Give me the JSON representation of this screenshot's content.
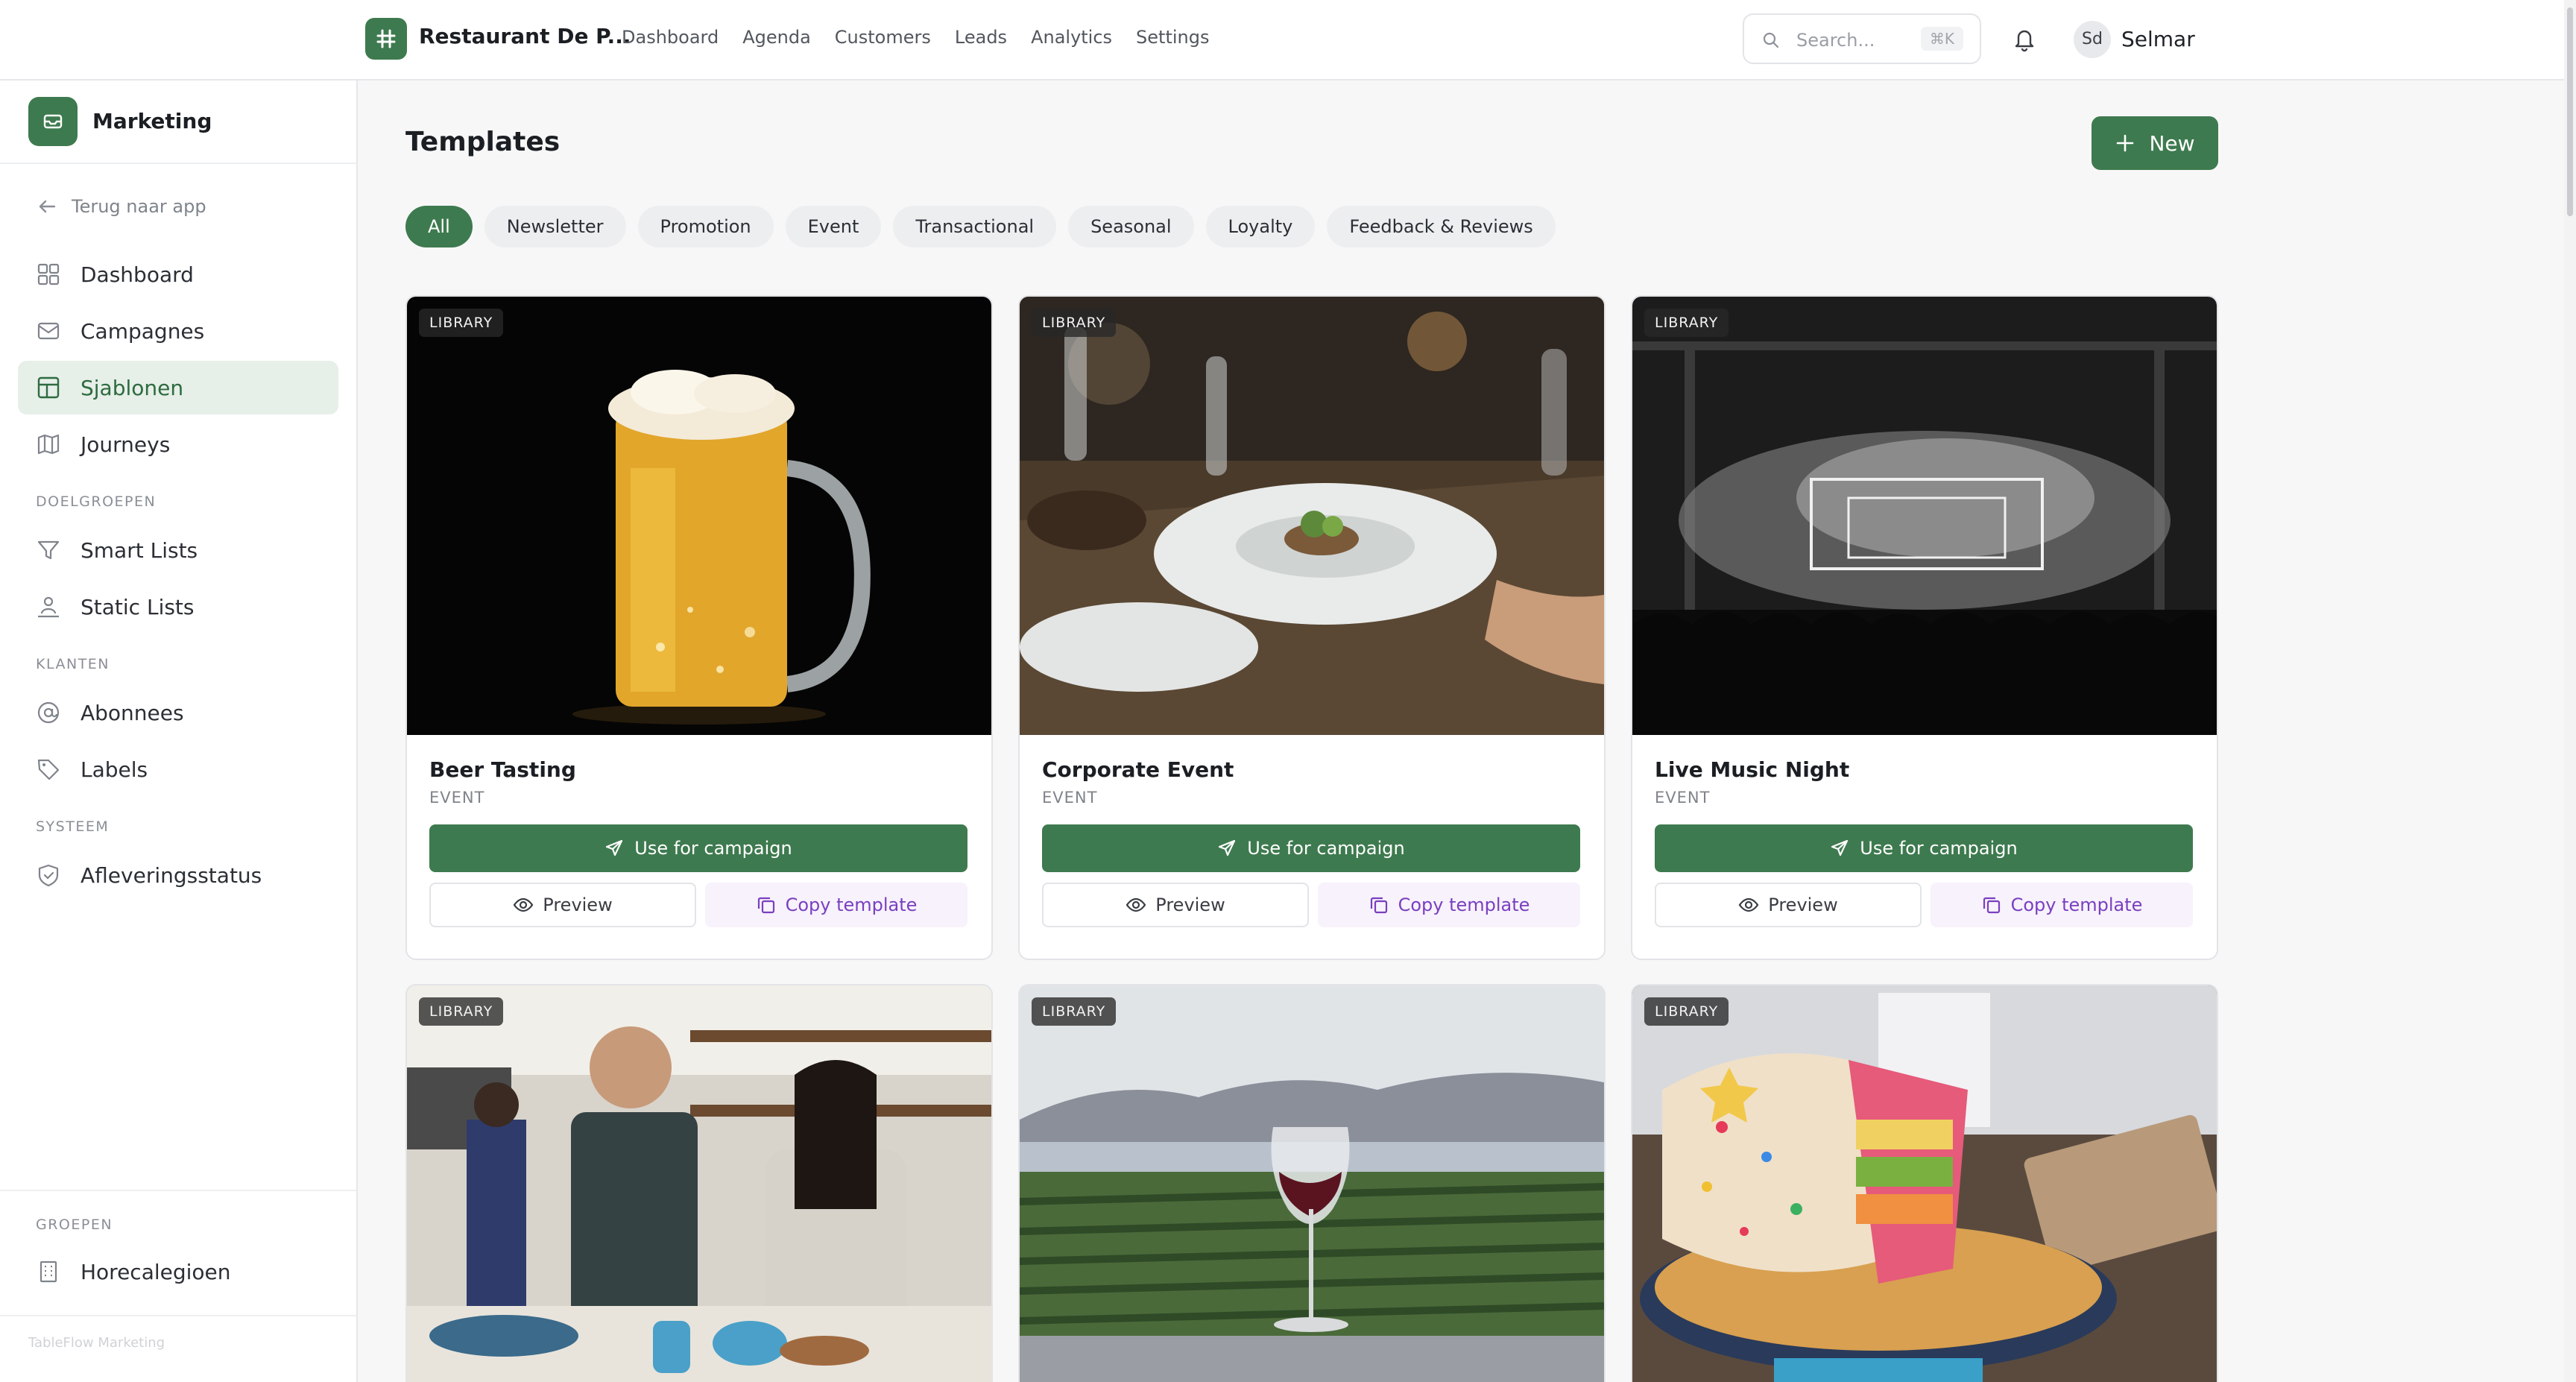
{
  "header": {
    "brand": "Restaurant De P...",
    "nav": [
      "Dashboard",
      "Agenda",
      "Customers",
      "Leads",
      "Analytics",
      "Settings"
    ],
    "search_placeholder": "Search...",
    "search_shortcut": "⌘K",
    "user_initials": "Sd",
    "user_name": "Selmar"
  },
  "sidebar": {
    "title": "Marketing",
    "back_label": "Terug naar app",
    "items": [
      {
        "label": "Dashboard",
        "icon": "grid-icon"
      },
      {
        "label": "Campagnes",
        "icon": "mail-icon"
      },
      {
        "label": "Sjablonen",
        "icon": "template-icon",
        "active": true
      },
      {
        "label": "Journeys",
        "icon": "map-icon"
      }
    ],
    "sections": [
      {
        "label": "DOELGROEPEN",
        "items": [
          {
            "label": "Smart Lists",
            "icon": "filter-icon"
          },
          {
            "label": "Static Lists",
            "icon": "users-icon"
          }
        ]
      },
      {
        "label": "KLANTEN",
        "items": [
          {
            "label": "Abonnees",
            "icon": "at-icon"
          },
          {
            "label": "Labels",
            "icon": "tag-icon"
          }
        ]
      },
      {
        "label": "SYSTEEM",
        "items": [
          {
            "label": "Afleveringsstatus",
            "icon": "shield-check-icon"
          }
        ]
      }
    ],
    "groups_label": "GROEPEN",
    "group_item": "Horecalegioen",
    "footer": "TableFlow Marketing"
  },
  "main": {
    "title": "Templates",
    "new_button": "New",
    "filters": [
      "All",
      "Newsletter",
      "Promotion",
      "Event",
      "Transactional",
      "Seasonal",
      "Loyalty",
      "Feedback & Reviews"
    ],
    "active_filter": "All",
    "badge_label": "LIBRARY",
    "use_label": "Use for campaign",
    "preview_label": "Preview",
    "copy_label": "Copy template",
    "templates": [
      {
        "title": "Beer Tasting",
        "category": "EVENT"
      },
      {
        "title": "Corporate Event",
        "category": "EVENT"
      },
      {
        "title": "Live Music Night",
        "category": "EVENT"
      },
      {
        "title": "",
        "category": ""
      },
      {
        "title": "",
        "category": ""
      },
      {
        "title": "",
        "category": ""
      }
    ]
  },
  "colors": {
    "accent": "#3e7a4f",
    "accent_soft": "#e6efe8",
    "copy_text": "#7a3fbf",
    "copy_bg": "#f7f2fc"
  }
}
